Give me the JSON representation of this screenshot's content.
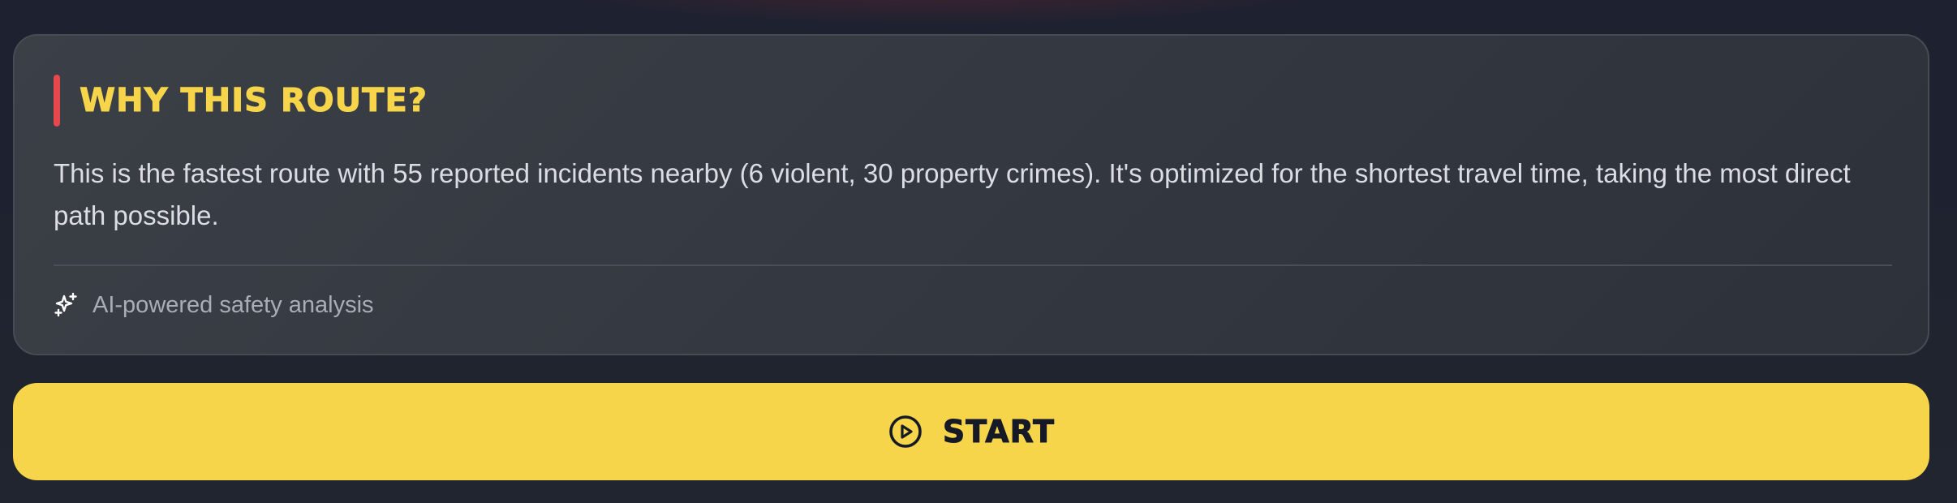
{
  "card": {
    "title": "WHY THIS ROUTE?",
    "description": "This is the fastest route with 55 reported incidents nearby (6 violent, 30 property crimes). It's optimized for the shortest travel time, taking the most direct path possible.",
    "footer_text": "AI-powered safety analysis",
    "footer_icon": "sparkles-icon"
  },
  "start_button": {
    "label": "START",
    "icon": "play-circle-icon"
  },
  "colors": {
    "accent_red": "#e5484d",
    "brand_yellow": "#f7d54a",
    "card_background": "#373b43",
    "page_background": "#1e2330"
  }
}
